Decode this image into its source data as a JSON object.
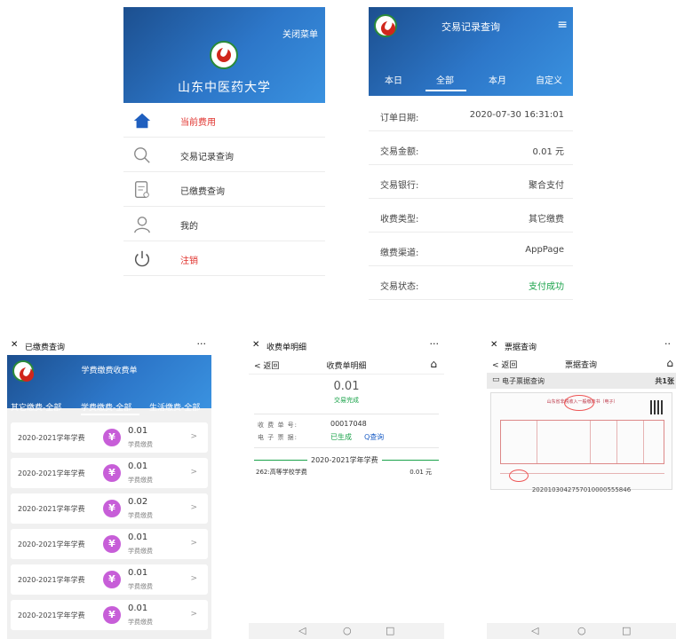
{
  "panel_menu": {
    "close_label": "关闭菜单",
    "university": "山东中医药大学",
    "items": [
      {
        "label": "当前费用",
        "icon": "home-icon",
        "active": true
      },
      {
        "label": "交易记录查询",
        "icon": "search-icon"
      },
      {
        "label": "已缴费查询",
        "icon": "document-icon"
      },
      {
        "label": "我的",
        "icon": "user-icon"
      },
      {
        "label": "注销",
        "icon": "power-icon",
        "danger": true
      }
    ]
  },
  "panel_detail": {
    "title": "交易记录查询",
    "menu_icon": "≡",
    "tabs": [
      "本日",
      "全部",
      "本月",
      "自定义"
    ],
    "active_tab": 1,
    "rows": [
      {
        "key": "订单日期:",
        "value": "2020-07-30 16:31:01"
      },
      {
        "key": "交易金额:",
        "value": "0.01 元"
      },
      {
        "key": "交易银行:",
        "value": "聚合支付"
      },
      {
        "key": "收费类型:",
        "value": "其它缴费"
      },
      {
        "key": "缴费渠道:",
        "value": "AppPage"
      },
      {
        "key": "交易状态:",
        "value": "支付成功",
        "status": true
      }
    ]
  },
  "panel_paid": {
    "bar_title": "已缴费查询",
    "header_title": "学费缴费收费单",
    "tabs": [
      "其它缴费-全部",
      "学费缴费-全部",
      "生活缴费-全部"
    ],
    "active_tab": 1,
    "cards": [
      {
        "year": "2020-2021学年学费",
        "amount": "0.01",
        "type": "学费缴费"
      },
      {
        "year": "2020-2021学年学费",
        "amount": "0.01",
        "type": "学费缴费"
      },
      {
        "year": "2020-2021学年学费",
        "amount": "0.02",
        "type": "学费缴费"
      },
      {
        "year": "2020-2021学年学费",
        "amount": "0.01",
        "type": "学费缴费"
      },
      {
        "year": "2020-2021学年学费",
        "amount": "0.01",
        "type": "学费缴费"
      },
      {
        "year": "2020-2021学年学费",
        "amount": "0.01",
        "type": "学费缴费"
      }
    ]
  },
  "panel_receipt": {
    "bar_title": "收费单明细",
    "back": "< 返回",
    "nav_title": "收费单明细",
    "amount": "0.01",
    "status": "交易完成",
    "receipt_no_label": "收 费 单 号:",
    "receipt_no": "00017048",
    "einvoice_label": "电 子 票 据:",
    "einvoice_status": "已生成",
    "query_link": "Q查询",
    "year": "2020-2021学年学费",
    "item_name": "262:高等学校学费",
    "item_amount": "0.01 元"
  },
  "panel_invoice": {
    "bar_title": "票据查询",
    "back": "< 返回",
    "nav_title": "票据查询",
    "section": "电子票据查询",
    "count": "共1张",
    "invoice_title": "山东省非税收入一般缴款书（电子）",
    "code": "2020103042757010000555846"
  }
}
